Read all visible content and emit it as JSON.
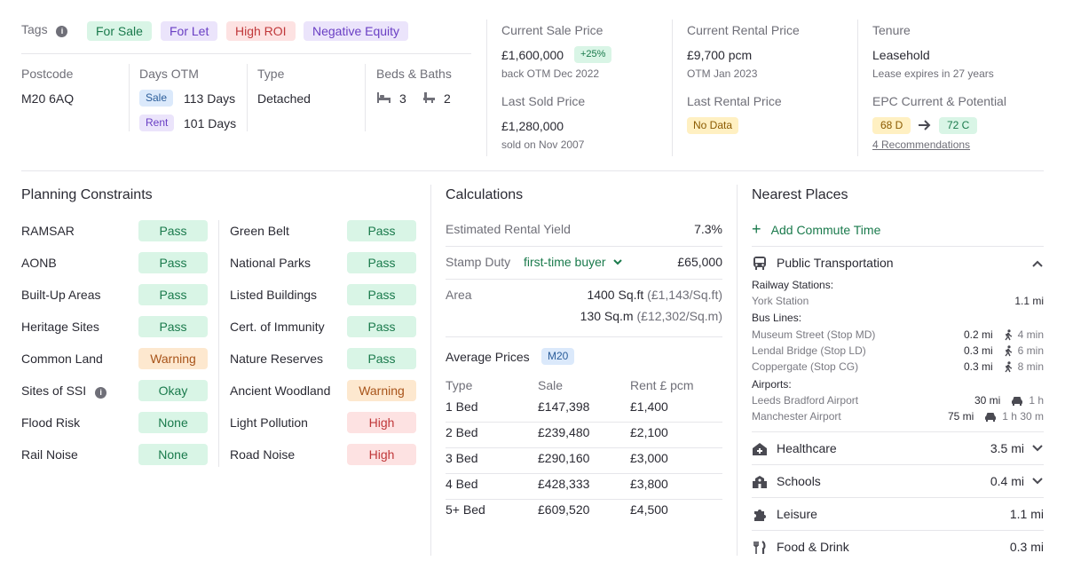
{
  "tags": {
    "label": "Tags",
    "items": [
      "For Sale",
      "For Let",
      "High ROI",
      "Negative Equity"
    ]
  },
  "summary": {
    "postcode_label": "Postcode",
    "postcode": "M20 6AQ",
    "otm_label": "Days OTM",
    "otm_sale_badge": "Sale",
    "otm_sale_value": "113 Days",
    "otm_rent_badge": "Rent",
    "otm_rent_value": "101 Days",
    "type_label": "Type",
    "type_value": "Detached",
    "beds_label": "Beds & Baths",
    "beds": "3",
    "baths": "2"
  },
  "prices": {
    "current_sale_label": "Current Sale Price",
    "current_sale": "£1,600,000",
    "current_sale_change": "+25%",
    "current_sale_note": "back OTM Dec 2022",
    "last_sold_label": "Last Sold Price",
    "last_sold": "£1,280,000",
    "last_sold_note": "sold on Nov 2007",
    "current_rental_label": "Current Rental Price",
    "current_rental": "£9,700 pcm",
    "current_rental_note": "OTM Jan 2023",
    "last_rental_label": "Last Rental Price",
    "last_rental": "No Data",
    "tenure_label": "Tenure",
    "tenure": "Leasehold",
    "tenure_note": "Lease expires in 27 years",
    "epc_label": "EPC Current & Potential",
    "epc_current": "68 D",
    "epc_potential": "72 C",
    "epc_link": "4 Recommendations"
  },
  "planning": {
    "title": "Planning Constraints",
    "left": [
      {
        "label": "RAMSAR",
        "status": "Pass",
        "kind": "pass"
      },
      {
        "label": "AONB",
        "status": "Pass",
        "kind": "pass"
      },
      {
        "label": "Built-Up Areas",
        "status": "Pass",
        "kind": "pass"
      },
      {
        "label": "Heritage Sites",
        "status": "Pass",
        "kind": "pass"
      },
      {
        "label": "Common Land",
        "status": "Warning",
        "kind": "warn"
      },
      {
        "label": "Sites of SSI",
        "status": "Okay",
        "kind": "okay"
      },
      {
        "label": "Flood Risk",
        "status": "None",
        "kind": "none"
      },
      {
        "label": "Rail Noise",
        "status": "None",
        "kind": "none"
      }
    ],
    "right": [
      {
        "label": "Green Belt",
        "status": "Pass",
        "kind": "pass"
      },
      {
        "label": "National Parks",
        "status": "Pass",
        "kind": "pass"
      },
      {
        "label": "Listed Buildings",
        "status": "Pass",
        "kind": "pass"
      },
      {
        "label": "Cert. of Immunity",
        "status": "Pass",
        "kind": "pass"
      },
      {
        "label": "Nature Reserves",
        "status": "Pass",
        "kind": "pass"
      },
      {
        "label": "Ancient Woodland",
        "status": "Warning",
        "kind": "warn"
      },
      {
        "label": "Light Pollution",
        "status": "High",
        "kind": "high"
      },
      {
        "label": "Road Noise",
        "status": "High",
        "kind": "high"
      }
    ]
  },
  "calculations": {
    "title": "Calculations",
    "yield_label": "Estimated Rental Yield",
    "yield_value": "7.3%",
    "stamp_label": "Stamp Duty",
    "stamp_option": "first-time buyer",
    "stamp_value": "£65,000",
    "area_label": "Area",
    "area_sqft": "1400 Sq.ft",
    "area_sqft_price": "(£1,143/Sq.ft)",
    "area_sqm": "130 Sq.m",
    "area_sqm_price": "(£12,302/Sq.m)",
    "avg_label": "Average Prices",
    "avg_badge": "M20",
    "columns": [
      "Type",
      "Sale",
      "Rent £ pcm"
    ],
    "rows": [
      [
        "1 Bed",
        "£147,398",
        "£1,400"
      ],
      [
        "2 Bed",
        "£239,480",
        "£2,100"
      ],
      [
        "3 Bed",
        "£290,160",
        "£3,000"
      ],
      [
        "4 Bed",
        "£428,333",
        "£3,800"
      ],
      [
        "5+ Bed",
        "£609,520",
        "£4,500"
      ]
    ]
  },
  "nearest": {
    "title": "Nearest Places",
    "add_commute": "Add Commute Time",
    "transport_label": "Public Transportation",
    "railway_label": "Railway Stations:",
    "railway": [
      {
        "name": "York Station",
        "dist": "1.1 mi"
      }
    ],
    "bus_label": "Bus Lines:",
    "bus": [
      {
        "name": "Museum Street (Stop MD)",
        "dist": "0.2 mi",
        "time": "4 min"
      },
      {
        "name": "Lendal Bridge (Stop LD)",
        "dist": "0.3 mi",
        "time": "6 min"
      },
      {
        "name": "Coppergate (Stop CG)",
        "dist": "0.3 mi",
        "time": "8 min"
      }
    ],
    "airports_label": "Airports:",
    "airports": [
      {
        "name": "Leeds Bradford Airport",
        "dist": "30 mi",
        "time": "1 h"
      },
      {
        "name": "Manchester Airport",
        "dist": "75 mi",
        "time": "1 h 30 m"
      }
    ],
    "categories": [
      {
        "label": "Healthcare",
        "dist": "3.5 mi",
        "icon": "hospital-icon"
      },
      {
        "label": "Schools",
        "dist": "0.4 mi",
        "icon": "school-icon"
      },
      {
        "label": "Leisure",
        "dist": "1.1 mi",
        "icon": "puzzle-icon"
      },
      {
        "label": "Food & Drink",
        "dist": "0.3 mi",
        "icon": "cutlery-icon"
      }
    ]
  },
  "colors": {
    "accent_green": "#1a7a4c",
    "pass_bg": "#d9f5e6",
    "warn_bg": "#fde8cf",
    "high_bg": "#fde2e2"
  }
}
